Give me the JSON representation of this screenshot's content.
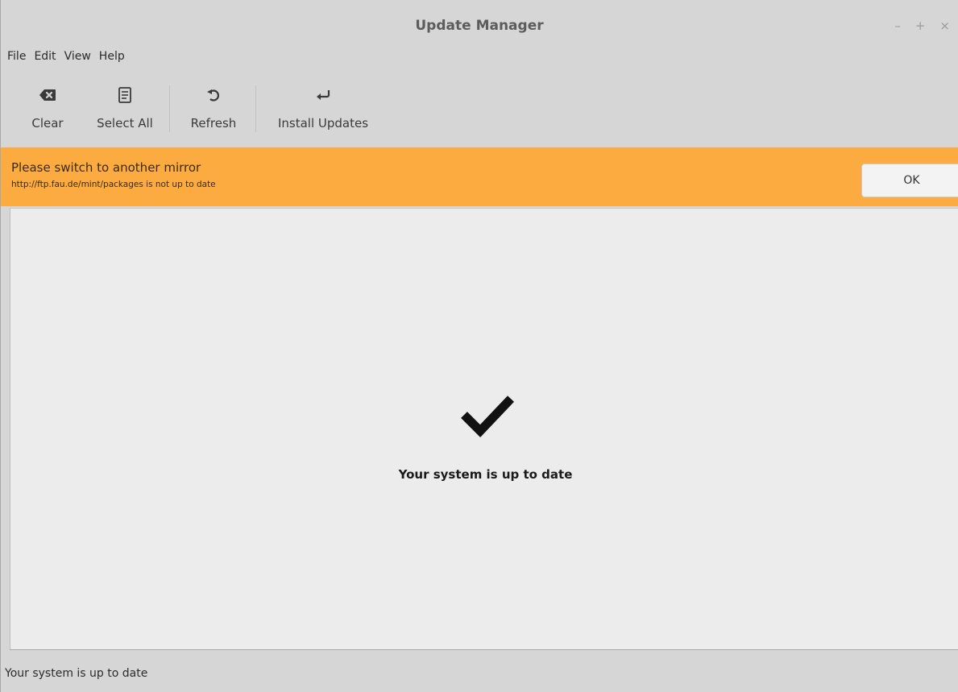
{
  "window": {
    "title": "Update Manager",
    "controls": {
      "minimize": "–",
      "maximize": "+",
      "close": "×"
    }
  },
  "menubar": {
    "items": [
      {
        "label": "File"
      },
      {
        "label": "Edit"
      },
      {
        "label": "View"
      },
      {
        "label": "Help"
      }
    ]
  },
  "toolbar": {
    "clear": {
      "label": "Clear",
      "icon": "clear-icon"
    },
    "select_all": {
      "label": "Select All",
      "icon": "select-all-icon"
    },
    "refresh": {
      "label": "Refresh",
      "icon": "refresh-icon"
    },
    "install": {
      "label": "Install Updates",
      "icon": "install-icon"
    }
  },
  "infobar": {
    "title": "Please switch to another mirror",
    "message": "http://ftp.fau.de/mint/packages is not up to date",
    "ok_label": "OK",
    "color": "#fbab3f"
  },
  "main": {
    "icon": "checkmark-icon",
    "message": "Your system is up to date"
  },
  "statusbar": {
    "text": "Your system is up to date"
  }
}
